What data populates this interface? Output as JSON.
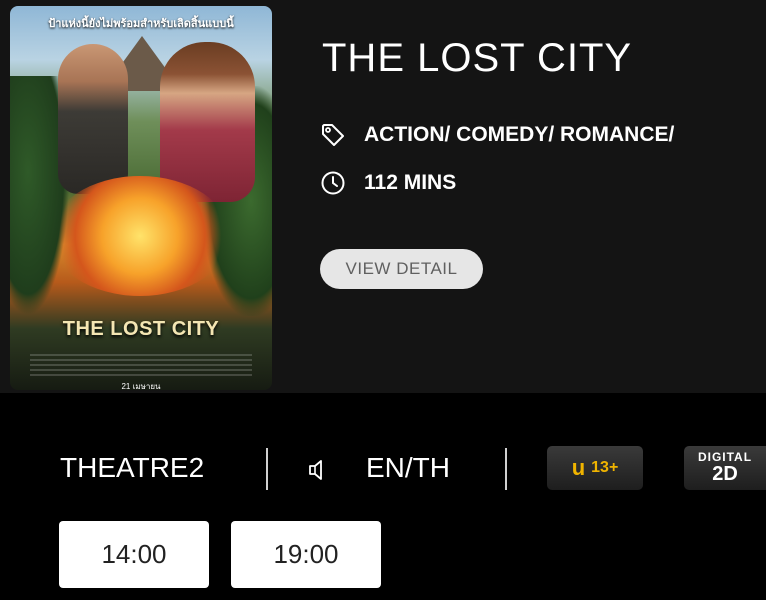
{
  "movie": {
    "title": "THE LOST CITY",
    "genres": "ACTION/ COMEDY/ ROMANCE/",
    "duration": "112 MINS",
    "view_detail_label": "VIEW DETAIL",
    "genre_icon": "tag-icon",
    "duration_icon": "clock-icon"
  },
  "poster": {
    "tagline": "ป้าแห่งนี้ยังไม่พร้อมสำหรับเลิดสิ้นแบบนี้",
    "title_text": "THE LOST CITY",
    "release_text": "21 เมษายน"
  },
  "showing": {
    "theatre": "THEATRE2",
    "audio_icon": "speaker-icon",
    "language": "EN/TH",
    "rating_letter": "u",
    "rating_age": "13+",
    "format_top": "DIGITAL",
    "format_main": "2D",
    "rating_color": "#f0b400"
  },
  "showtimes": [
    "14:00",
    "19:00"
  ]
}
